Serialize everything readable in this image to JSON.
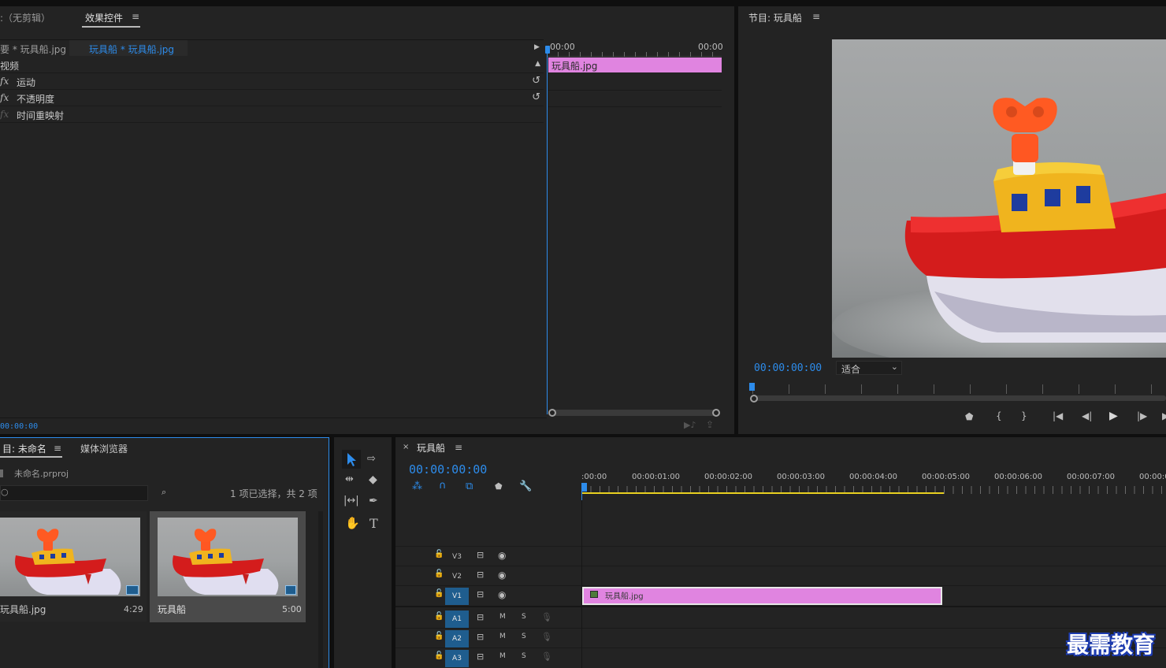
{
  "effect_controls": {
    "source_tab": ":（无剪辑）",
    "tab": "效果控件",
    "master": "要 * 玩具船.jpg",
    "clip": "玩具船 * 玩具船.jpg",
    "section": "视频",
    "effects": [
      {
        "name": "运动"
      },
      {
        "name": "不透明度"
      },
      {
        "name": "时间重映射"
      }
    ],
    "ruler_start": "00:00",
    "ruler_end": "00:00",
    "clip_bar_label": "玩具船.jpg",
    "timecode": "00:00:00"
  },
  "program": {
    "title": "节目: 玩具船",
    "timecode": "00:00:00:00",
    "zoom": "适合"
  },
  "project": {
    "tab": "目: 未命名",
    "tab2": "媒体浏览器",
    "file": "未命名.prproj",
    "selection": "1 项已选择，共 2 项",
    "items": [
      {
        "name": "玩具船.jpg",
        "duration": "4:29"
      },
      {
        "name": "玩具船",
        "duration": "5:00"
      }
    ]
  },
  "timeline": {
    "title": "玩具船",
    "timecode": "00:00:00:00",
    "ruler": [
      ":00:00",
      "00:00:01:00",
      "00:00:02:00",
      "00:00:03:00",
      "00:00:04:00",
      "00:00:05:00",
      "00:00:06:00",
      "00:00:07:00",
      "00:00:0"
    ],
    "video_tracks": [
      "V3",
      "V2",
      "V1"
    ],
    "audio_tracks": [
      "A1",
      "A2",
      "A3"
    ],
    "mute": "M",
    "solo": "S",
    "clip_label": "玩具船.jpg"
  },
  "watermark": "最需教育"
}
